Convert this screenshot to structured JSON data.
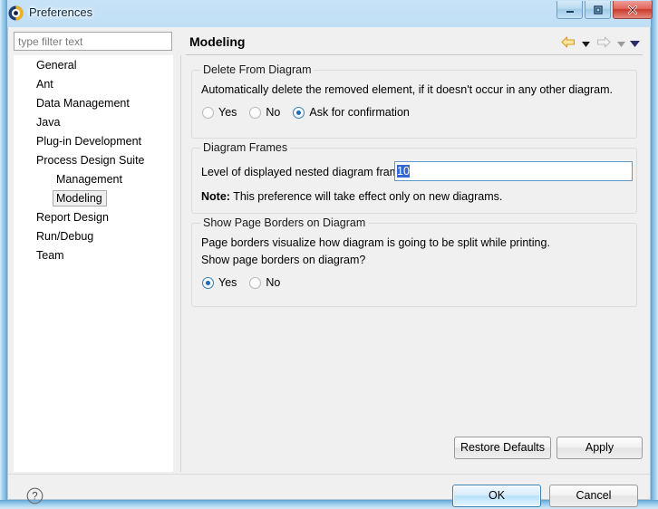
{
  "window": {
    "title": "Preferences",
    "icon": "preferences-app-icon",
    "controls": {
      "minimize": "minimize-button",
      "maximize": "maximize-button",
      "close": "close-button"
    }
  },
  "sidebar": {
    "filter": {
      "placeholder": "type filter text",
      "value": ""
    },
    "items": [
      {
        "label": "General",
        "level": 1,
        "selected": false
      },
      {
        "label": "Ant",
        "level": 1,
        "selected": false
      },
      {
        "label": "Data Management",
        "level": 1,
        "selected": false
      },
      {
        "label": "Java",
        "level": 1,
        "selected": false
      },
      {
        "label": "Plug-in Development",
        "level": 1,
        "selected": false
      },
      {
        "label": "Process Design Suite",
        "level": 1,
        "selected": false
      },
      {
        "label": "Management",
        "level": 2,
        "selected": false
      },
      {
        "label": "Modeling",
        "level": 2,
        "selected": true
      },
      {
        "label": "Report Design",
        "level": 1,
        "selected": false
      },
      {
        "label": "Run/Debug",
        "level": 1,
        "selected": false
      },
      {
        "label": "Team",
        "level": 1,
        "selected": false
      }
    ]
  },
  "content": {
    "title": "Modeling",
    "nav": {
      "back": "back-arrow-icon",
      "back_menu": "back-dropdown-icon",
      "forward": "forward-arrow-icon",
      "forward_menu": "forward-dropdown-icon",
      "view_menu": "view-menu-icon"
    },
    "groups": {
      "delete_from_diagram": {
        "title": "Delete From Diagram",
        "description": "Automatically delete the removed element, if it doesn't occur in any other diagram.",
        "options": [
          {
            "label": "Yes",
            "checked": false
          },
          {
            "label": "No",
            "checked": false
          },
          {
            "label": "Ask for confirmation",
            "checked": true
          }
        ]
      },
      "diagram_frames": {
        "title": "Diagram Frames",
        "field_label": "Level of displayed nested diagram frames:",
        "field_value": "10",
        "note_label": "Note:",
        "note_text": "This preference will take effect only on new diagrams."
      },
      "page_borders": {
        "title": "Show Page Borders on Diagram",
        "description_line1": "Page borders visualize how diagram is going to be split while printing.",
        "description_line2": "Show page borders on diagram?",
        "options": [
          {
            "label": "Yes",
            "checked": true
          },
          {
            "label": "No",
            "checked": false
          }
        ]
      }
    },
    "buttons": {
      "restore_defaults": "Restore Defaults",
      "apply": "Apply"
    }
  },
  "footer": {
    "help": "help-icon",
    "ok": "OK",
    "cancel": "Cancel"
  },
  "colors": {
    "accent": "#1d6ab5",
    "selection": "#3399ff",
    "title_bar": "#9ccdf0",
    "close_button": "#c93a2c",
    "back_arrow": "#e5a62b"
  }
}
